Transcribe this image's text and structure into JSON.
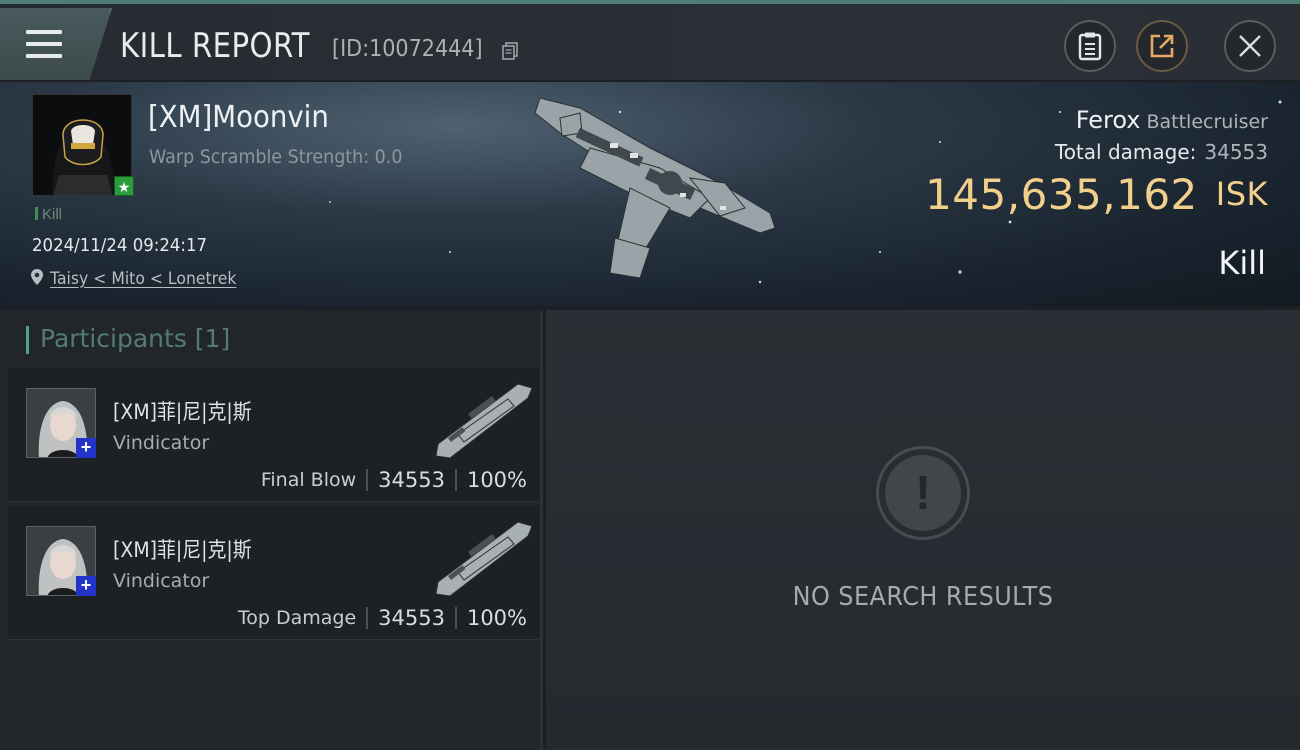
{
  "header": {
    "title": "KILL REPORT",
    "report_id": "[ID:10072444]"
  },
  "victim": {
    "name": "[XM]Moonvin",
    "warp_scramble": "Warp Scramble Strength: 0.0",
    "tag": "Kill",
    "timestamp": "2024/11/24 09:24:17",
    "location": "Taisy < Mito < Lonetrek",
    "ship_name": "Ferox",
    "ship_class": "Battlecruiser",
    "total_damage_label": "Total damage:",
    "total_damage_value": "34553",
    "isk_value": "145,635,162",
    "isk_unit": "ISK",
    "result_label": "Kill"
  },
  "participants": {
    "title": "Participants [1]",
    "items": [
      {
        "name": "[XM]菲|尼|克|斯",
        "ship": "Vindicator",
        "role": "Final Blow",
        "damage": "34553",
        "percent": "100%"
      },
      {
        "name": "[XM]菲|尼|克|斯",
        "ship": "Vindicator",
        "role": "Top Damage",
        "damage": "34553",
        "percent": "100%"
      }
    ]
  },
  "results": {
    "empty_text": "NO SEARCH RESULTS"
  },
  "colors": {
    "accent_teal": "#4ea38d",
    "isk_gold": "#f2cf8a",
    "corp_badge_green": "#2a9c3c",
    "plus_badge_blue": "#2335c9"
  },
  "icons": {
    "menu": "hamburger-menu-icon",
    "copy": "copy-icon",
    "clipboard": "clipboard-icon",
    "share": "share-icon",
    "close": "close-icon",
    "location": "location-pin-icon",
    "empty": "exclamation-icon"
  }
}
